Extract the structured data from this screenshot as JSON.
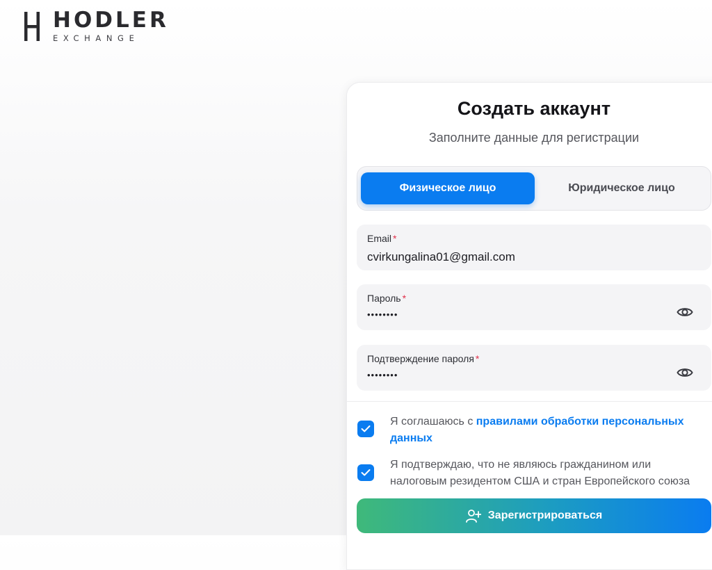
{
  "brand": {
    "name": "HODLER",
    "subtitle": "EXCHANGE"
  },
  "form": {
    "title": "Создать аккаунт",
    "subtitle": "Заполните данные для регистрации",
    "tabs": [
      {
        "label": "Физическое лицо",
        "active": true
      },
      {
        "label": "Юридическое лицо",
        "active": false
      }
    ],
    "email": {
      "label": "Email",
      "required_mark": "*",
      "value": "cvirkungalina01@gmail.com"
    },
    "password": {
      "label": "Пароль",
      "required_mark": "*",
      "value": "••••••••"
    },
    "confirm_password": {
      "label": "Подтверждение пароля",
      "required_mark": "*",
      "value": "••••••••"
    },
    "agreements": [
      {
        "checked": true,
        "text": "Я соглашаюсь с ",
        "link": "правилами обработки персональных данных"
      },
      {
        "checked": true,
        "text": "Я подтверждаю, что не являюсь гражданином или налоговым резидентом США и стран Европейского союза"
      }
    ],
    "submit_label": "Зарегистрироваться"
  },
  "colors": {
    "accent": "#0a7cf0",
    "gradient_start": "#3fb97a",
    "required": "#e0304a"
  },
  "icons": [
    "logo-mark-icon",
    "eye-icon",
    "check-icon",
    "user-plus-icon"
  ]
}
